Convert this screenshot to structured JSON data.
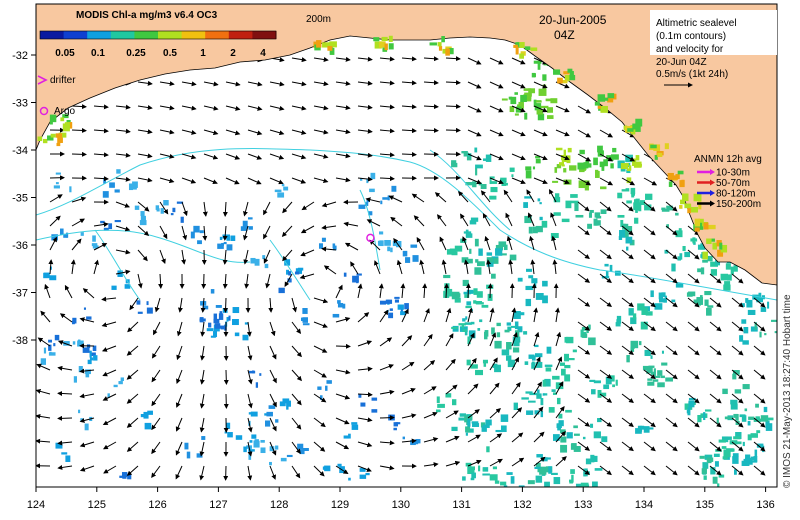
{
  "map": {
    "background_land_color": "#f8c8a0",
    "ocean_color": "#ffffff",
    "contour_color": "#40d0e0",
    "arrow_color": "#000000"
  },
  "colorbar": {
    "title": "MODIS Chl-a mg/m3 v6.4 OC3",
    "tick_labels": [
      "0.05",
      "0.1",
      "0.25",
      "0.5",
      "1",
      "2",
      "4"
    ],
    "colors": [
      "#0a1aa0",
      "#1040d0",
      "#10a0e0",
      "#20c8a0",
      "#40c840",
      "#b0e020",
      "#f0c010",
      "#f07010",
      "#c02010",
      "#801010"
    ]
  },
  "labels": {
    "isobath": "200m",
    "date": "20-Jun-2005",
    "time": "04Z",
    "legend_lines": [
      "Altimetric sealevel",
      "(0.1m contours)",
      "and velocity for",
      "20-Jun 04Z",
      "0.5m/s (1kt 24h)"
    ],
    "drifter": "drifter",
    "argo": "Argo",
    "anmn_title": "ANMN 12h avg",
    "credit": "© IMOS 21-May-2013 18:27:40 Hobart time"
  },
  "anmn_depths": [
    {
      "label": "10-30m",
      "color": "#e020e0"
    },
    {
      "label": "50-70m",
      "color": "#e02020"
    },
    {
      "label": "80-120m",
      "color": "#2020e0"
    },
    {
      "label": "150-200m",
      "color": "#000000"
    }
  ],
  "axes": {
    "lon_labels": [
      "124",
      "125",
      "126",
      "127",
      "128",
      "129",
      "130",
      "131",
      "132",
      "133",
      "134",
      "135",
      "136"
    ],
    "lat_labels": [
      "-32",
      "-33",
      "-34",
      "-35",
      "-36",
      "-37",
      "-38"
    ]
  },
  "markers": {
    "argo_float": {
      "lon": 129.5,
      "lat": -35.85
    }
  }
}
